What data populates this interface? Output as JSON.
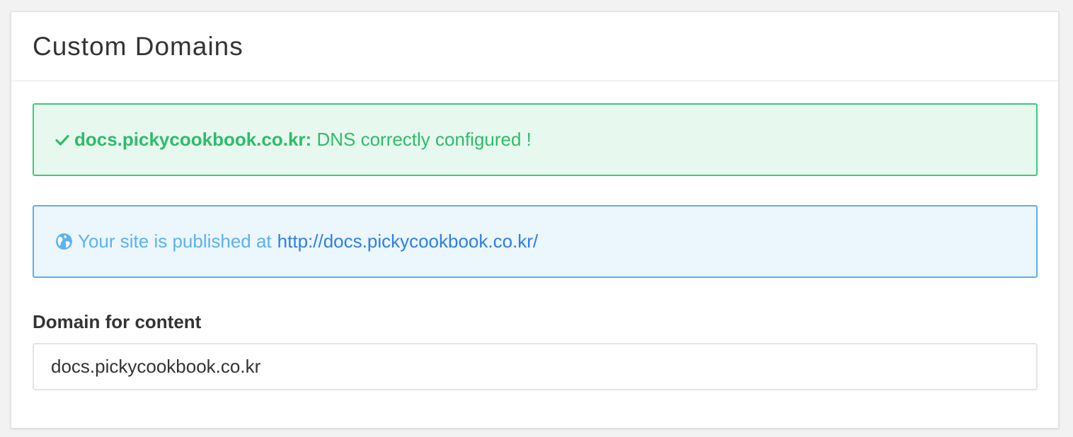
{
  "panel": {
    "title": "Custom Domains"
  },
  "alerts": {
    "dns": {
      "icon": "check-icon",
      "domain": "docs.pickycookbook.co.kr:",
      "message": "DNS correctly configured !",
      "color": "#2ebc6a",
      "background": "#e7f8ef",
      "border": "#3ec97a"
    },
    "published": {
      "icon": "globe-icon",
      "message": "Your site is published at",
      "url": "http://docs.pickycookbook.co.kr/",
      "color": "#5cb2ec",
      "link_color": "#2f7fe0",
      "background": "#ebf6fd",
      "border": "#5aaff0"
    }
  },
  "domain_field": {
    "label": "Domain for content",
    "value": "docs.pickycookbook.co.kr"
  }
}
